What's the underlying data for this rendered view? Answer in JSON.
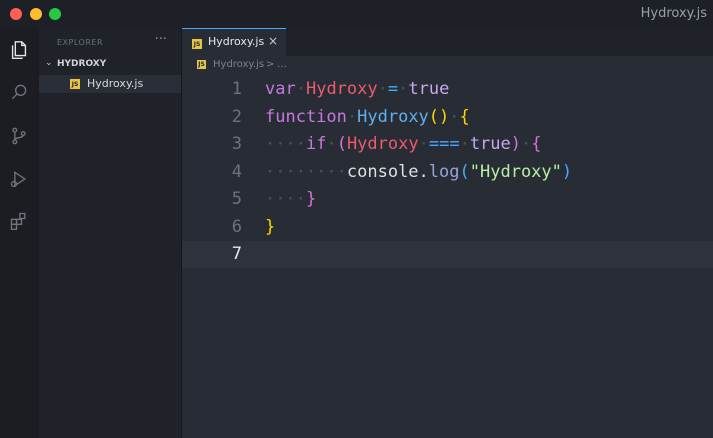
{
  "window": {
    "title": "Hydroxy.js"
  },
  "activity_bar": {
    "icons": [
      "files-icon",
      "search-icon",
      "source-control-icon",
      "run-debug-icon",
      "extensions-icon"
    ]
  },
  "sidebar": {
    "title": "EXPLORER",
    "more": "···",
    "folder": "HYDROXY",
    "files": [
      {
        "badge": "JS",
        "name": "Hydroxy.js"
      }
    ]
  },
  "tabs": [
    {
      "badge": "JS",
      "label": "Hydroxy.js",
      "close": "×"
    }
  ],
  "breadcrumb": {
    "badge": "JS",
    "file": "Hydroxy.js",
    "sep": ">",
    "more": "…"
  },
  "editor": {
    "active_line": 7,
    "lines": [
      {
        "number": "1",
        "tokens": [
          {
            "t": "var",
            "c": "kw"
          },
          {
            "t": "·",
            "c": "ws"
          },
          {
            "t": "Hydroxy",
            "c": "var"
          },
          {
            "t": "·",
            "c": "ws"
          },
          {
            "t": "=",
            "c": "op"
          },
          {
            "t": "·",
            "c": "ws"
          },
          {
            "t": "true",
            "c": "bool"
          }
        ]
      },
      {
        "number": "2",
        "tokens": [
          {
            "t": "function",
            "c": "kw"
          },
          {
            "t": "·",
            "c": "ws"
          },
          {
            "t": "Hydroxy",
            "c": "fn"
          },
          {
            "t": "()",
            "c": "paren1"
          },
          {
            "t": "·",
            "c": "ws"
          },
          {
            "t": "{",
            "c": "paren1"
          }
        ]
      },
      {
        "number": "3",
        "tokens": [
          {
            "t": "····",
            "c": "ws"
          },
          {
            "t": "if",
            "c": "kw"
          },
          {
            "t": "·",
            "c": "ws"
          },
          {
            "t": "(",
            "c": "paren2"
          },
          {
            "t": "Hydroxy",
            "c": "var"
          },
          {
            "t": "·",
            "c": "ws"
          },
          {
            "t": "===",
            "c": "op"
          },
          {
            "t": "·",
            "c": "ws"
          },
          {
            "t": "true",
            "c": "bool"
          },
          {
            "t": ")",
            "c": "paren2"
          },
          {
            "t": "·",
            "c": "ws"
          },
          {
            "t": "{",
            "c": "paren2"
          }
        ]
      },
      {
        "number": "4",
        "tokens": [
          {
            "t": "········",
            "c": "ws"
          },
          {
            "t": "console",
            "c": "plain"
          },
          {
            "t": ".",
            "c": "plain"
          },
          {
            "t": "log",
            "c": "meth"
          },
          {
            "t": "(",
            "c": "paren3"
          },
          {
            "t": "\"Hydroxy\"",
            "c": "str"
          },
          {
            "t": ")",
            "c": "paren3"
          }
        ]
      },
      {
        "number": "5",
        "tokens": [
          {
            "t": "····",
            "c": "ws"
          },
          {
            "t": "}",
            "c": "paren2"
          }
        ]
      },
      {
        "number": "6",
        "tokens": [
          {
            "t": "}",
            "c": "paren1"
          }
        ]
      },
      {
        "number": "7",
        "tokens": []
      }
    ]
  },
  "colors": {
    "keyword": "#c678dd",
    "variable": "#ef596f",
    "function": "#61afef",
    "string": "#b7f0a3",
    "boolean": "#c7a8f0",
    "accent": "#4aa8ff"
  }
}
